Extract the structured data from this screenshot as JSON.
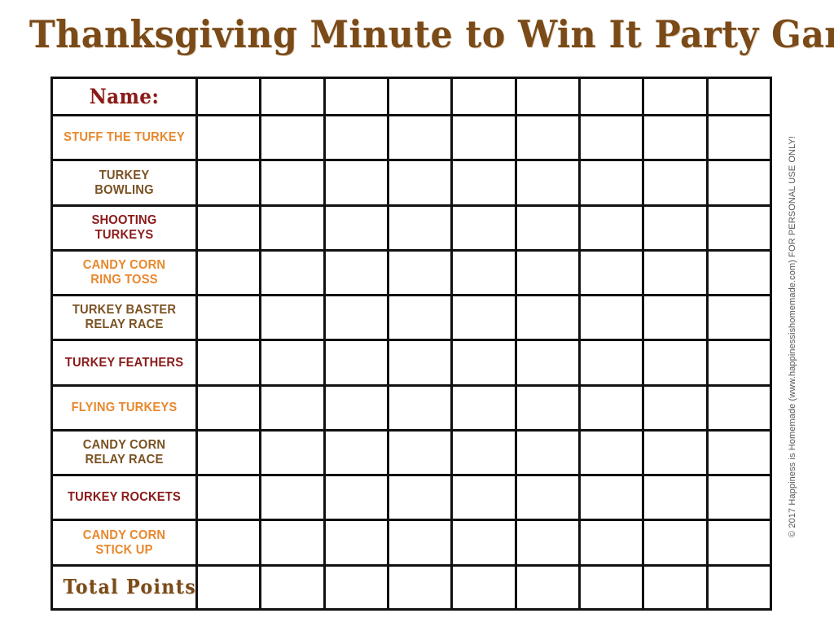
{
  "page": {
    "title": "Thanksgiving Minute to Win It Party Games",
    "background_color": "#ffffff"
  },
  "colors": {
    "title_brown": "#7a4a18",
    "label_orange": "#e8882e",
    "label_brown": "#7a5223",
    "label_red": "#8b1a1a",
    "grid_line": "#111111"
  },
  "table": {
    "score_column_count": 9,
    "header": {
      "label": "Name:",
      "color_key": "red",
      "style": "western"
    },
    "rows": [
      {
        "label": "STUFF THE TURKEY",
        "lines": [
          "STUFF THE TURKEY"
        ],
        "color_key": "orange"
      },
      {
        "label": "TURKEY BOWLING",
        "lines": [
          "TURKEY",
          "BOWLING"
        ],
        "color_key": "brown"
      },
      {
        "label": "SHOOTING TURKEYS",
        "lines": [
          "SHOOTING",
          "TURKEYS"
        ],
        "color_key": "red"
      },
      {
        "label": "CANDY CORN RING TOSS",
        "lines": [
          "CANDY CORN",
          "RING TOSS"
        ],
        "color_key": "orange"
      },
      {
        "label": "TURKEY BASTER RELAY RACE",
        "lines": [
          "TURKEY BASTER",
          "RELAY RACE"
        ],
        "color_key": "brown"
      },
      {
        "label": "TURKEY FEATHERS",
        "lines": [
          "TURKEY FEATHERS"
        ],
        "color_key": "red"
      },
      {
        "label": "FLYING TURKEYS",
        "lines": [
          "FLYING TURKEYS"
        ],
        "color_key": "orange"
      },
      {
        "label": "CANDY CORN RELAY RACE",
        "lines": [
          "CANDY CORN",
          "RELAY RACE"
        ],
        "color_key": "brown"
      },
      {
        "label": "TURKEY ROCKETS",
        "lines": [
          "TURKEY ROCKETS"
        ],
        "color_key": "red"
      },
      {
        "label": "CANDY CORN STICK UP",
        "lines": [
          "CANDY CORN",
          "STICK UP"
        ],
        "color_key": "orange"
      }
    ],
    "total_row": {
      "label": "Total  Points",
      "color_key": "brown",
      "style": "western"
    }
  },
  "copyright": {
    "text": "© 2017  Happiness is Homemade  (www.happinessishomemade.com)   FOR PERSONAL USE ONLY!"
  }
}
